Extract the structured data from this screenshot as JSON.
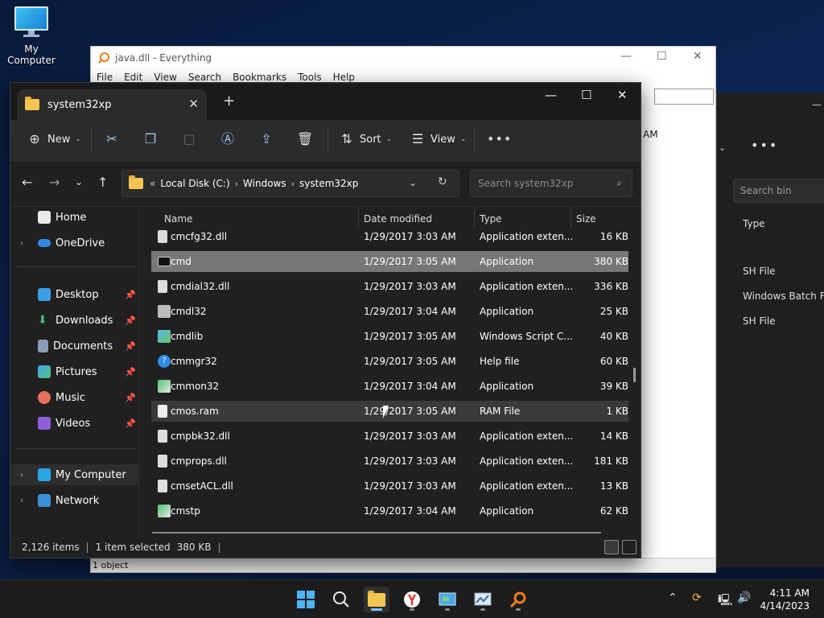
{
  "desktop": {
    "icon_label": "My Computer"
  },
  "everything": {
    "title": "java.dll - Everything",
    "menu": [
      "File",
      "Edit",
      "View",
      "Search",
      "Bookmarks",
      "Tools",
      "Help"
    ],
    "partial_time": "AM",
    "status": "1 object"
  },
  "bin_window": {
    "search_placeholder": "Search bin",
    "type_header": "Type",
    "rows": [
      "SH File",
      "Windows Batch File",
      "SH File"
    ]
  },
  "explorer": {
    "tab_title": "system32xp",
    "toolbar": {
      "new_label": "New",
      "sort_label": "Sort",
      "view_label": "View"
    },
    "address": {
      "prefix": "«",
      "crumbs": [
        "Local Disk (C:)",
        "Windows",
        "system32xp"
      ]
    },
    "search_placeholder": "Search system32xp",
    "nav": [
      {
        "label": "Home"
      },
      {
        "label": "OneDrive"
      },
      {
        "label": "Desktop"
      },
      {
        "label": "Downloads"
      },
      {
        "label": "Documents"
      },
      {
        "label": "Pictures"
      },
      {
        "label": "Music"
      },
      {
        "label": "Videos"
      },
      {
        "label": "My Computer"
      },
      {
        "label": "Network"
      }
    ],
    "columns": {
      "name": "Name",
      "date": "Date modified",
      "type": "Type",
      "size": "Size"
    },
    "files": [
      {
        "name": "cmcfg32.dll",
        "date": "1/29/2017 3:03 AM",
        "type": "Application exten...",
        "size": "16 KB"
      },
      {
        "name": "cmd",
        "date": "1/29/2017 3:05 AM",
        "type": "Application",
        "size": "380 KB"
      },
      {
        "name": "cmdial32.dll",
        "date": "1/29/2017 3:03 AM",
        "type": "Application exten...",
        "size": "336 KB"
      },
      {
        "name": "cmdl32",
        "date": "1/29/2017 3:04 AM",
        "type": "Application",
        "size": "25 KB"
      },
      {
        "name": "cmdlib",
        "date": "1/29/2017 3:05 AM",
        "type": "Windows Script C...",
        "size": "40 KB"
      },
      {
        "name": "cmmgr32",
        "date": "1/29/2017 3:05 AM",
        "type": "Help file",
        "size": "60 KB"
      },
      {
        "name": "cmmon32",
        "date": "1/29/2017 3:04 AM",
        "type": "Application",
        "size": "39 KB"
      },
      {
        "name": "cmos.ram",
        "date": "1/29/2017 3:05 AM",
        "type": "RAM File",
        "size": "1 KB"
      },
      {
        "name": "cmpbk32.dll",
        "date": "1/29/2017 3:03 AM",
        "type": "Application exten...",
        "size": "14 KB"
      },
      {
        "name": "cmprops.dll",
        "date": "1/29/2017 3:03 AM",
        "type": "Application exten...",
        "size": "181 KB"
      },
      {
        "name": "cmsetACL.dll",
        "date": "1/29/2017 3:03 AM",
        "type": "Application exten...",
        "size": "13 KB"
      },
      {
        "name": "cmstp",
        "date": "1/29/2017 3:04 AM",
        "type": "Application",
        "size": "62 KB"
      }
    ],
    "status": {
      "count": "2,126 items",
      "selected": "1 item selected",
      "size": "380 KB"
    }
  },
  "taskbar": {
    "time": "4:11 AM",
    "date": "4/14/2023"
  },
  "colors": {
    "accent": "#7cc3ff",
    "selected_row": "#777777",
    "folder": "#f4c553"
  }
}
